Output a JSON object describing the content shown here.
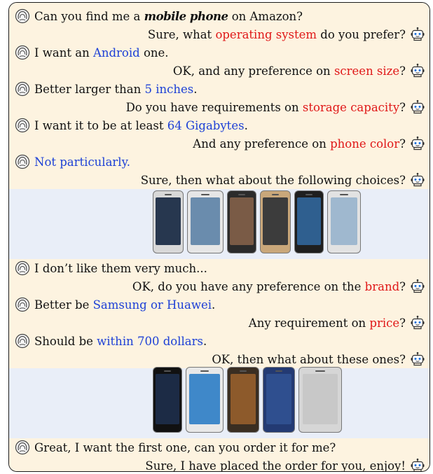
{
  "colors": {
    "request": "#e01818",
    "answer": "#1d40d6",
    "cream_band": "#fdf3e0",
    "lavender_band": "#e9eef8"
  },
  "icons": {
    "user": "user-avatar-icon",
    "bot": "robot-icon"
  },
  "dialogue": [
    {
      "speaker": "user",
      "parts": [
        {
          "t": "Can you find me a "
        },
        {
          "t": "mobile phone",
          "style": "scribble"
        },
        {
          "t": " on Amazon?"
        }
      ]
    },
    {
      "speaker": "bot",
      "parts": [
        {
          "t": "Sure, what "
        },
        {
          "t": "operating system",
          "style": "red"
        },
        {
          "t": " do you prefer?"
        }
      ]
    },
    {
      "speaker": "user",
      "parts": [
        {
          "t": "I want an "
        },
        {
          "t": "Android",
          "style": "blue"
        },
        {
          "t": " one."
        }
      ]
    },
    {
      "speaker": "bot",
      "parts": [
        {
          "t": "OK, and any preference on "
        },
        {
          "t": "screen size",
          "style": "red"
        },
        {
          "t": "?"
        }
      ]
    },
    {
      "speaker": "user",
      "parts": [
        {
          "t": "Better larger than "
        },
        {
          "t": "5 inches",
          "style": "blue"
        },
        {
          "t": "."
        }
      ]
    },
    {
      "speaker": "bot",
      "parts": [
        {
          "t": "Do you have requirements on "
        },
        {
          "t": "storage capacity",
          "style": "red"
        },
        {
          "t": "?"
        }
      ]
    },
    {
      "speaker": "user",
      "parts": [
        {
          "t": "I want it to be at least "
        },
        {
          "t": "64 Gigabytes",
          "style": "blue"
        },
        {
          "t": "."
        }
      ]
    },
    {
      "speaker": "bot",
      "parts": [
        {
          "t": "And any preference on "
        },
        {
          "t": "phone color",
          "style": "red"
        },
        {
          "t": "?"
        }
      ]
    },
    {
      "speaker": "user",
      "parts": [
        {
          "t": "Not particularly.",
          "style": "blue"
        }
      ]
    },
    {
      "speaker": "bot",
      "parts": [
        {
          "t": "Sure, then what about the following choices?"
        }
      ]
    },
    {
      "speaker": "user",
      "parts": [
        {
          "t": "I don’t like them very much..."
        }
      ]
    },
    {
      "speaker": "bot",
      "parts": [
        {
          "t": "OK, do you have any preference on the "
        },
        {
          "t": "brand",
          "style": "red"
        },
        {
          "t": "?"
        }
      ]
    },
    {
      "speaker": "user",
      "parts": [
        {
          "t": "Better be "
        },
        {
          "t": "Samsung or Huawei",
          "style": "blue"
        },
        {
          "t": "."
        }
      ]
    },
    {
      "speaker": "bot",
      "parts": [
        {
          "t": "Any requirement on "
        },
        {
          "t": "price",
          "style": "red"
        },
        {
          "t": "?"
        }
      ]
    },
    {
      "speaker": "user",
      "parts": [
        {
          "t": "Should be "
        },
        {
          "t": "within 700 dollars",
          "style": "blue"
        },
        {
          "t": "."
        }
      ]
    },
    {
      "speaker": "bot",
      "parts": [
        {
          "t": "OK, then what about these ones?"
        }
      ]
    },
    {
      "speaker": "user",
      "parts": [
        {
          "t": "Great, I want the first one, can you order it for me?"
        }
      ]
    },
    {
      "speaker": "bot",
      "parts": [
        {
          "t": "Sure, I have placed the order for you, enjoy!"
        }
      ]
    }
  ],
  "galleries": [
    {
      "after_turn": 9,
      "phones": [
        {
          "body": "#d8d8d8",
          "screen": "#27374f"
        },
        {
          "body": "#e6e6e6",
          "screen": "#6a8cad"
        },
        {
          "body": "#2b2b2b",
          "screen": "#7a5b46"
        },
        {
          "body": "#c9a77a",
          "screen": "#3c3c3c"
        },
        {
          "body": "#1f1f1f",
          "screen": "#2f5f8f"
        },
        {
          "body": "#e2e2e2",
          "screen": "#9fb8cf"
        }
      ]
    },
    {
      "after_turn": 15,
      "phones": [
        {
          "body": "#111111",
          "screen": "#1c2b45"
        },
        {
          "body": "#e8e8e8",
          "screen": "#3f88c9"
        },
        {
          "body": "#3a2e22",
          "screen": "#8d5a2b"
        },
        {
          "body": "#233a73",
          "screen": "#2f4f8f"
        },
        {
          "body": "#d6d6d6",
          "screen": "#c8c8c8"
        }
      ]
    }
  ]
}
